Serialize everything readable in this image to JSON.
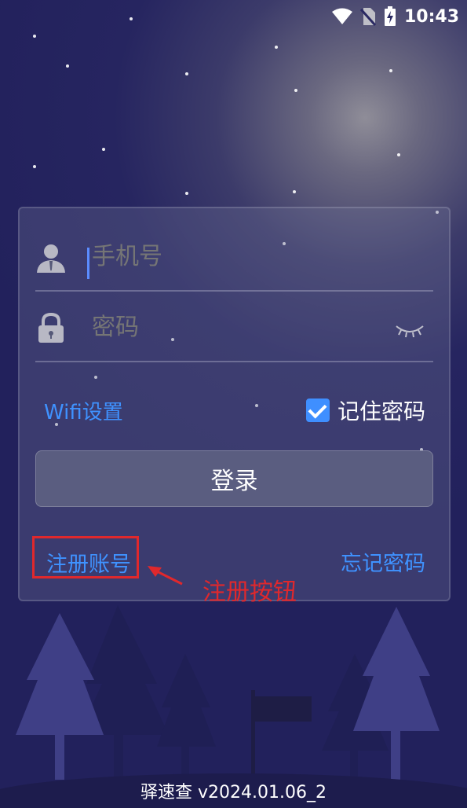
{
  "status_bar": {
    "time": "10:43"
  },
  "login": {
    "phone_placeholder": "手机号",
    "password_placeholder": "密码",
    "wifi_settings": "Wifi设置",
    "remember_password": "记住密码",
    "remember_checked": true,
    "login_button": "登录",
    "register": "注册账号",
    "forgot_password": "忘记密码"
  },
  "annotation": {
    "label": "注册按钮"
  },
  "footer": {
    "version": "驿速查  v2024.01.06_2"
  },
  "colors": {
    "accent": "#3f92ff",
    "annotation": "#e0282c",
    "background": "#22215c"
  }
}
